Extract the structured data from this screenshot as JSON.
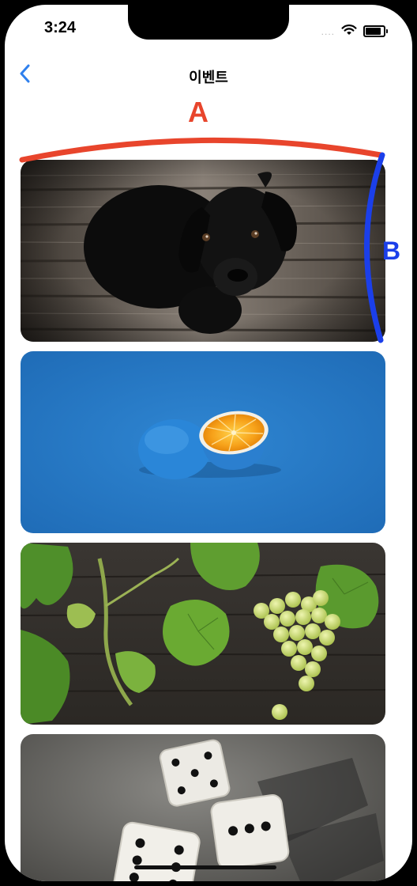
{
  "status_bar": {
    "time": "3:24",
    "signal": "....",
    "icons": [
      "wifi-icon",
      "battery-icon"
    ]
  },
  "nav": {
    "title": "이벤트",
    "back_icon": "chevron-left-icon",
    "accent_color": "#2F80ED"
  },
  "annotations": {
    "label_a": "A",
    "label_b": "B",
    "color_a": "#E8452C",
    "color_b": "#1B3FEA"
  },
  "event_cards": [
    {
      "image": "black-puppy-on-wooden-floor"
    },
    {
      "image": "blue-orange-on-blue-background"
    },
    {
      "image": "grapes-and-leaves-on-wood"
    },
    {
      "image": "dice-on-table"
    }
  ]
}
